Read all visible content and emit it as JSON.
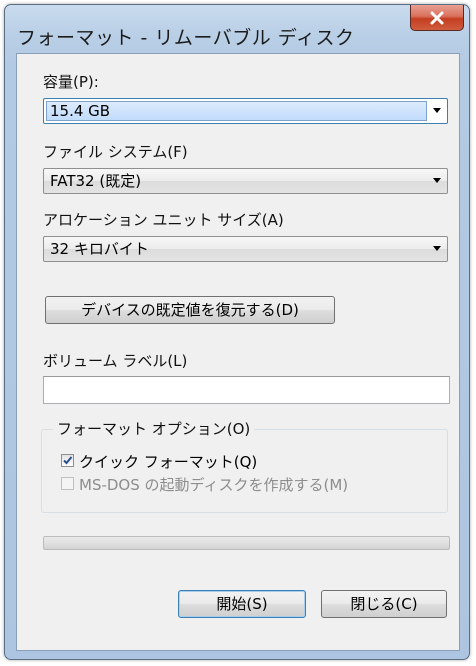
{
  "window": {
    "title": "フォーマット - リムーバブル ディスク"
  },
  "capacity": {
    "label": "容量(P):",
    "value": "15.4 GB"
  },
  "file_system": {
    "label": "ファイル システム(F)",
    "value": "FAT32 (既定)"
  },
  "allocation_unit": {
    "label": "アロケーション ユニット サイズ(A)",
    "value": "32 キロバイト"
  },
  "restore_defaults_button": "デバイスの既定値を復元する(D)",
  "volume_label": {
    "label": "ボリューム ラベル(L)",
    "value": ""
  },
  "format_options": {
    "title": "フォーマット オプション(O)",
    "quick_format": {
      "label": "クイック フォーマット(Q)",
      "checked": true,
      "enabled": true
    },
    "msdos_startup": {
      "label": "MS-DOS の起動ディスクを作成する(M)",
      "checked": false,
      "enabled": false
    }
  },
  "progress": {
    "value_percent": 0
  },
  "buttons": {
    "start": "開始(S)",
    "close": "閉じる(C)"
  },
  "colors": {
    "close_button": "#c43e22",
    "selection_highlight": "#c1dcfc",
    "frame": "#b9cfe6"
  },
  "icons": {
    "close": "close-x-icon",
    "dropdown": "chevron-down-icon",
    "checkmark": "checkmark-icon"
  }
}
